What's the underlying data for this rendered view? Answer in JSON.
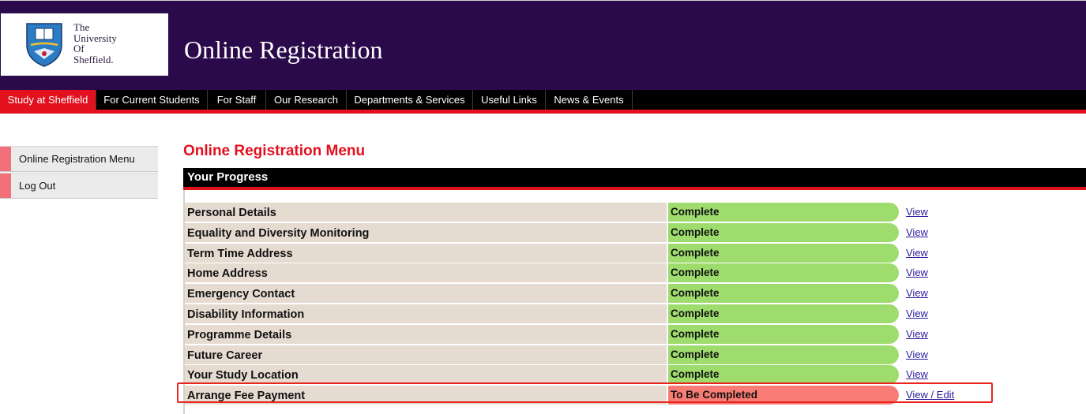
{
  "logo": {
    "lines": [
      "The",
      "University",
      "Of",
      "Sheffield."
    ],
    "crest_icon": "university-crest-icon"
  },
  "header": {
    "title": "Online Registration"
  },
  "nav": {
    "items": [
      {
        "label": "Study at Sheffield",
        "active": true
      },
      {
        "label": "For Current Students"
      },
      {
        "label": "For Staff"
      },
      {
        "label": "Our Research"
      },
      {
        "label": "Departments & Services"
      },
      {
        "label": "Useful Links"
      },
      {
        "label": "News & Events"
      }
    ]
  },
  "sidebar": {
    "items": [
      {
        "label": "Online Registration Menu"
      },
      {
        "label": "Log Out"
      }
    ]
  },
  "main": {
    "heading": "Online Registration Menu",
    "progress_title": "Your Progress",
    "rows": [
      {
        "name": "Personal Details",
        "status": "Complete",
        "action": "View"
      },
      {
        "name": "Equality and Diversity Monitoring",
        "status": "Complete",
        "action": "View"
      },
      {
        "name": "Term Time Address",
        "status": "Complete",
        "action": "View"
      },
      {
        "name": "Home Address",
        "status": "Complete",
        "action": "View"
      },
      {
        "name": "Emergency Contact",
        "status": "Complete",
        "action": "View"
      },
      {
        "name": "Disability Information",
        "status": "Complete",
        "action": "View"
      },
      {
        "name": "Programme Details",
        "status": "Complete",
        "action": "View"
      },
      {
        "name": "Future Career",
        "status": "Complete",
        "action": "View"
      },
      {
        "name": "Your Study Location",
        "status": "Complete",
        "action": "View"
      },
      {
        "name": "Arrange Fee Payment",
        "status": "To Be Completed",
        "action": "View / Edit"
      }
    ]
  },
  "colors": {
    "header_bg": "#2a0a4a",
    "accent_red": "#e3101e",
    "complete_green": "#9fdc6e",
    "pending_red": "#f97b75",
    "row_beige": "#e6dbd1",
    "link_blue": "#2a1a9e"
  }
}
